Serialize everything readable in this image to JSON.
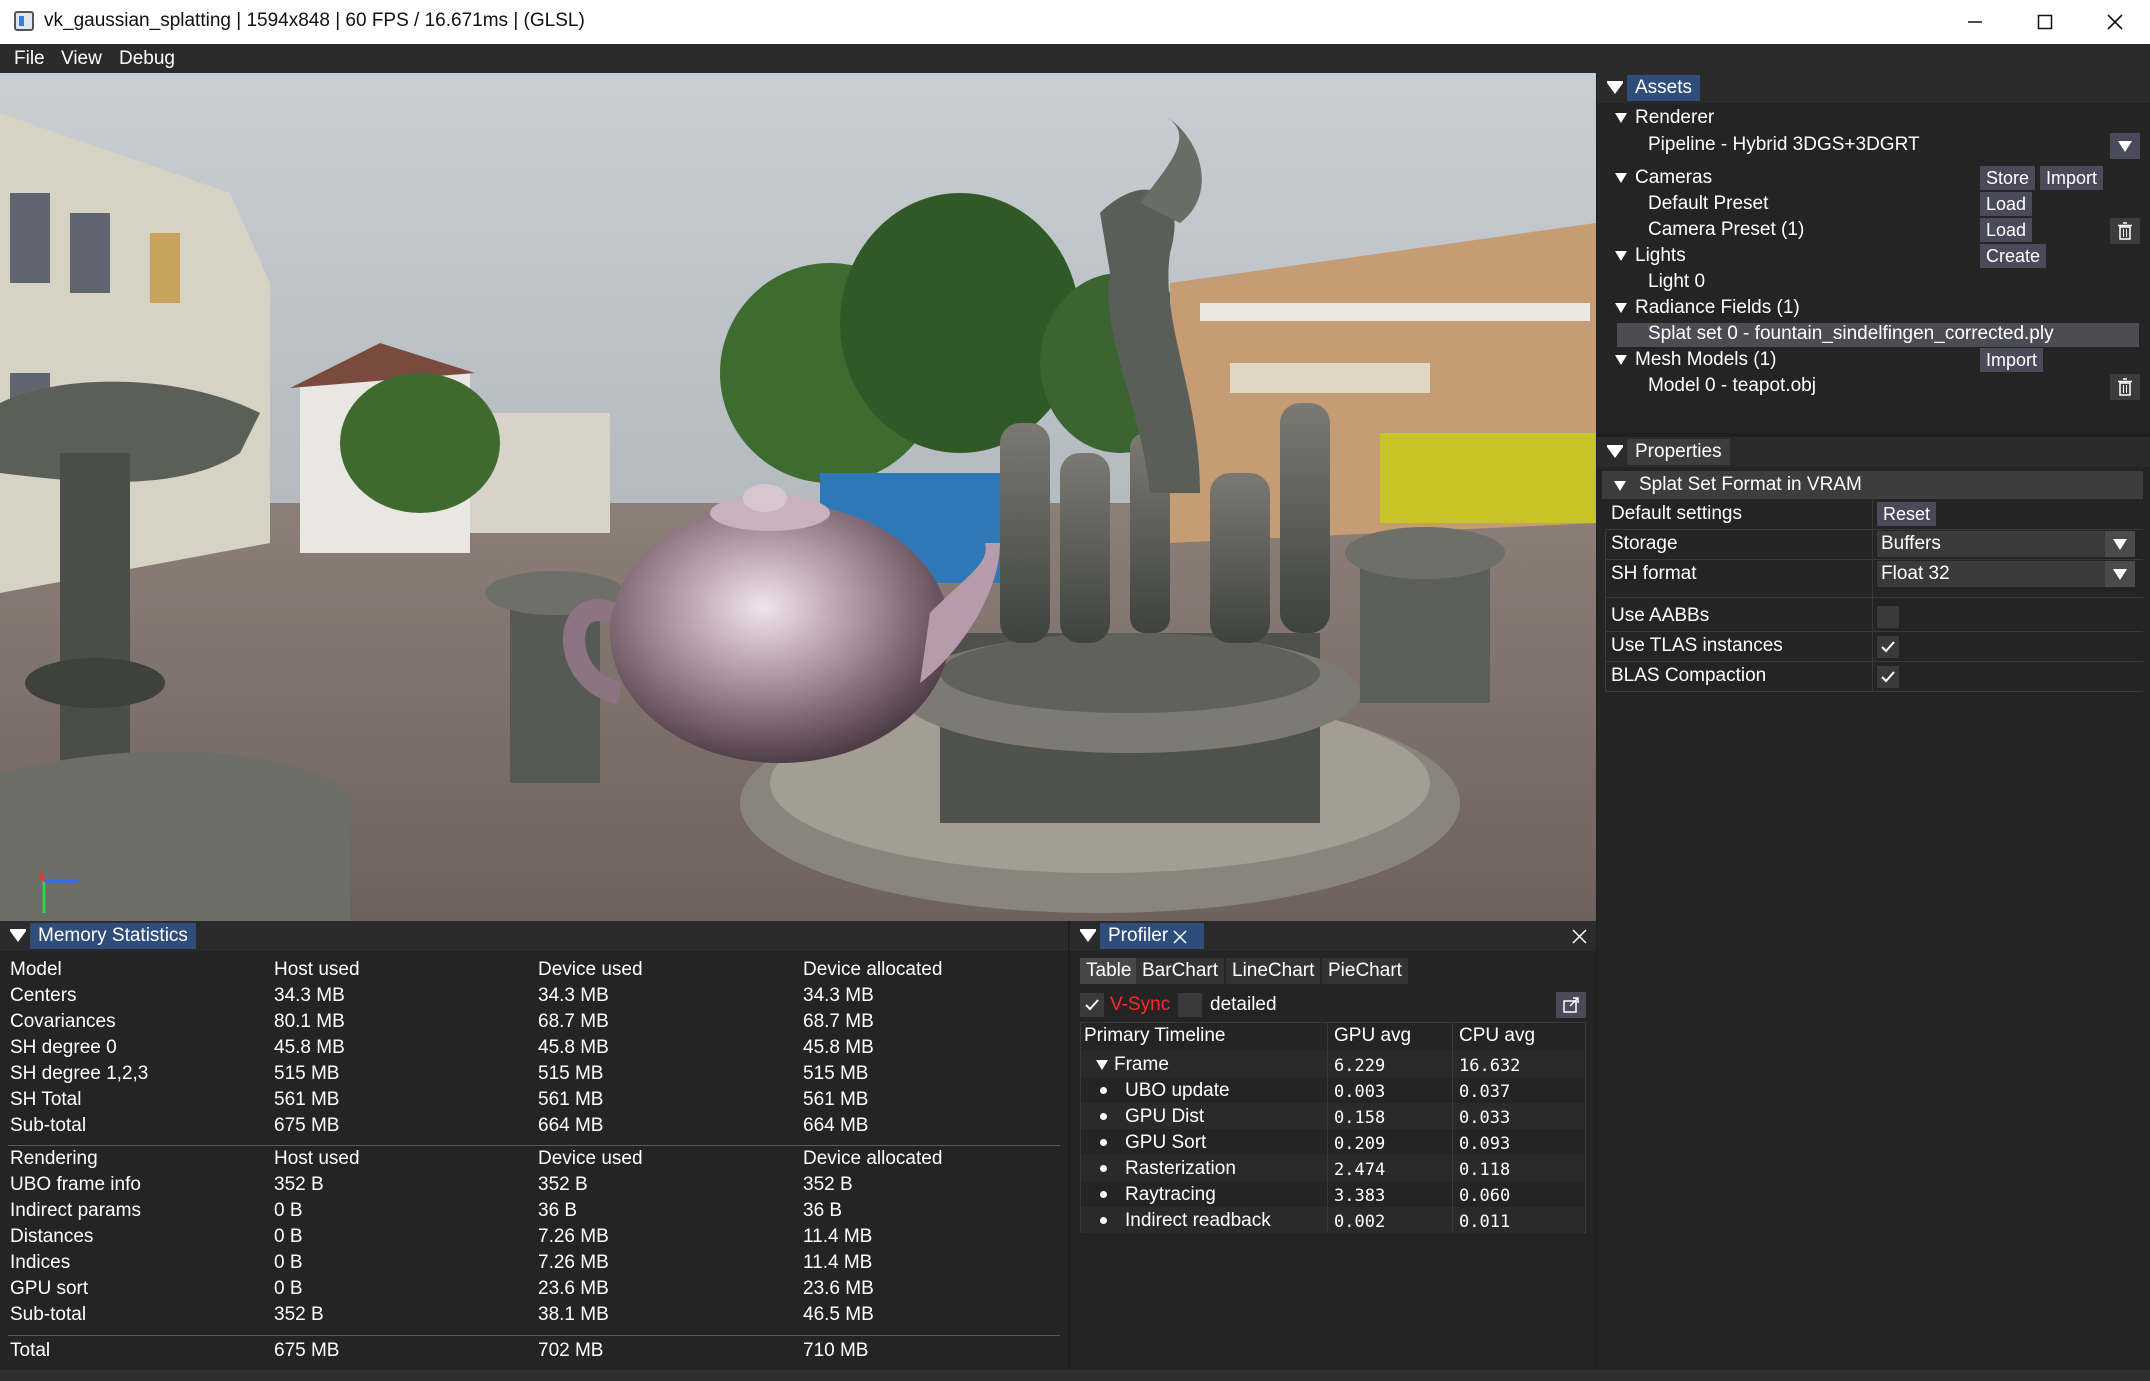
{
  "window": {
    "title": "vk_gaussian_splatting | 1594x848 | 60 FPS / 16.671ms | (GLSL)"
  },
  "menu": [
    "File",
    "View",
    "Debug"
  ],
  "assets": {
    "tab": "Assets",
    "renderer_label": "Renderer",
    "pipeline": "Pipeline - Hybrid 3DGS+3DGRT",
    "cameras_label": "Cameras",
    "store": "Store",
    "import": "Import",
    "default_preset": "Default Preset",
    "camera_preset": "Camera Preset (1)",
    "load": "Load",
    "lights_label": "Lights",
    "create": "Create",
    "light0": "Light 0",
    "radiance_label": "Radiance Fields (1)",
    "splat_set": "Splat set 0 - fountain_sindelfingen_corrected.ply",
    "mesh_label": "Mesh Models (1)",
    "model0": "Model 0 - teapot.obj"
  },
  "properties": {
    "tab": "Properties",
    "section": "Splat Set Format in VRAM",
    "default_settings": "Default settings",
    "reset": "Reset",
    "storage_label": "Storage",
    "storage_value": "Buffers",
    "sh_label": "SH format",
    "sh_value": "Float 32",
    "use_aabbs": "Use AABBs",
    "use_aabbs_checked": false,
    "use_tlas": "Use TLAS instances",
    "use_tlas_checked": true,
    "blas": "BLAS Compaction",
    "blas_checked": true
  },
  "memory": {
    "tab": "Memory Statistics",
    "model_headers": [
      "Model",
      "Host used",
      "Device used",
      "Device allocated"
    ],
    "model_rows": [
      [
        "Centers",
        "34.3 MB",
        "34.3 MB",
        "34.3 MB"
      ],
      [
        "Covariances",
        "80.1 MB",
        "68.7 MB",
        "68.7 MB"
      ],
      [
        "SH degree 0",
        "45.8 MB",
        "45.8 MB",
        "45.8 MB"
      ],
      [
        "SH degree 1,2,3",
        "515 MB",
        "515 MB",
        "515 MB"
      ],
      [
        "SH Total",
        "561 MB",
        "561 MB",
        "561 MB"
      ],
      [
        "Sub-total",
        "675 MB",
        "664 MB",
        "664 MB"
      ]
    ],
    "render_headers": [
      "Rendering",
      "Host used",
      "Device used",
      "Device allocated"
    ],
    "render_rows": [
      [
        "UBO frame info",
        "352 B",
        "352 B",
        "352 B"
      ],
      [
        "Indirect params",
        "0 B",
        "36 B",
        "36 B"
      ],
      [
        "Distances",
        "0 B",
        "7.26 MB",
        "11.4 MB"
      ],
      [
        "Indices",
        "0 B",
        "7.26 MB",
        "11.4 MB"
      ],
      [
        "GPU sort",
        "0 B",
        "23.6 MB",
        "23.6 MB"
      ],
      [
        "Sub-total",
        "352 B",
        "38.1 MB",
        "46.5 MB"
      ]
    ],
    "total_row": [
      "Total",
      "675 MB",
      "702 MB",
      "710 MB"
    ]
  },
  "profiler": {
    "tab": "Profiler",
    "subtabs": [
      "Table",
      "BarChart",
      "LineChart",
      "PieChart"
    ],
    "vsync": "V-Sync",
    "vsync_checked": true,
    "detailed": "detailed",
    "detailed_checked": false,
    "headers": [
      "Primary Timeline",
      "GPU avg",
      "CPU avg"
    ],
    "frame": [
      "Frame",
      "6.229",
      "16.632"
    ],
    "rows": [
      [
        "UBO update",
        "0.003",
        "0.037"
      ],
      [
        "GPU Dist",
        "0.158",
        "0.033"
      ],
      [
        "GPU Sort",
        "0.209",
        "0.093"
      ],
      [
        "Rasterization",
        "2.474",
        "0.118"
      ],
      [
        "Raytracing",
        "3.383",
        "0.060"
      ],
      [
        "Indirect readback",
        "0.002",
        "0.011"
      ]
    ]
  },
  "colors": {
    "accent_tab": "#2e4d7a",
    "selected_row": "#4c4c55",
    "vsync_red": "#ff2a2a"
  }
}
